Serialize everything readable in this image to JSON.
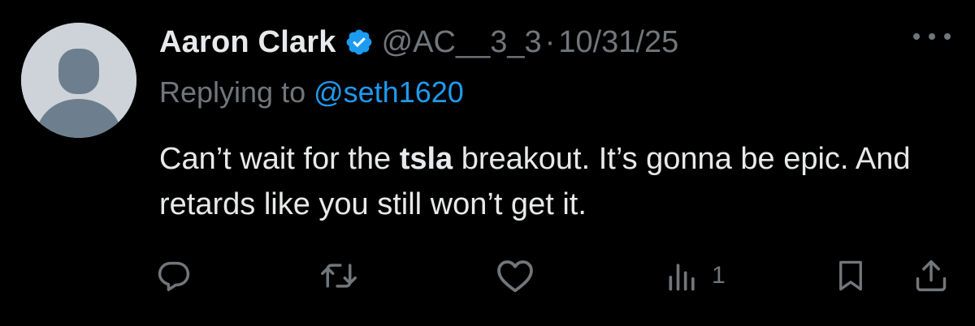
{
  "tweet": {
    "display_name": "Aaron Clark",
    "handle": "@AC__3_3",
    "separator": "·",
    "date": "10/31/25",
    "replying_prefix": "Replying to ",
    "replying_handle": "@seth1620",
    "text_before_bold": "Can’t wait for the ",
    "text_bold": "tsla",
    "text_after_bold": " breakout. It’s gonna be epic. And retards like you still won’t get it.",
    "verified": true
  },
  "actions": {
    "reply_icon": "reply-icon",
    "retweet_icon": "retweet-icon",
    "like_icon": "heart-icon",
    "views_icon": "views-icon",
    "views_count": "1",
    "bookmark_icon": "bookmark-icon",
    "share_icon": "share-icon"
  },
  "colors": {
    "background": "#000000",
    "primary_text": "#e7e9ea",
    "secondary_text": "#71767b",
    "accent": "#1d9bf0"
  }
}
